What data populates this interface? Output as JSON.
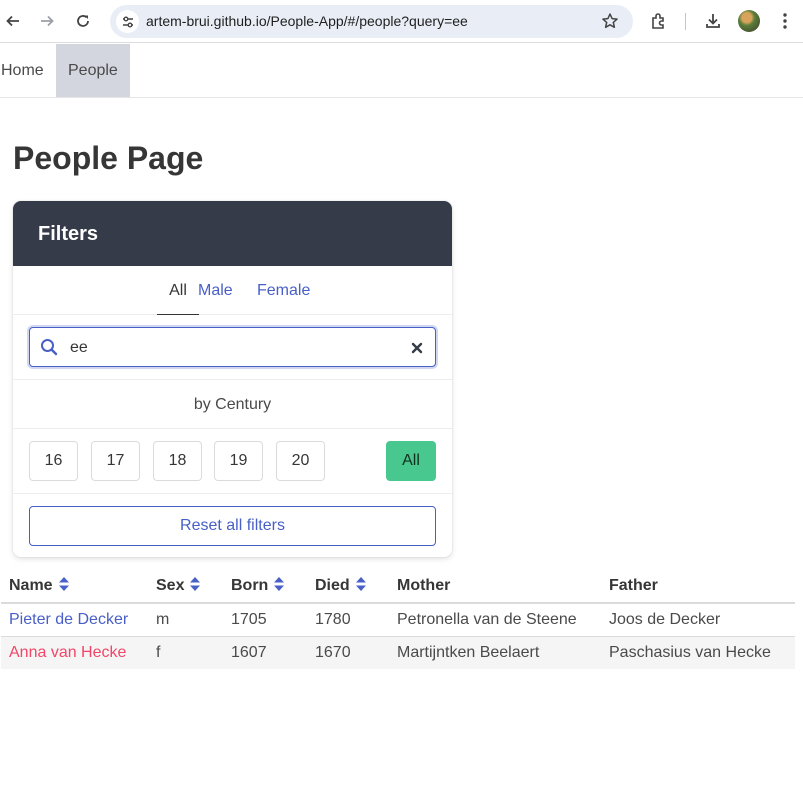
{
  "browser": {
    "url": "artem-brui.github.io/People-App/#/people?query=ee"
  },
  "navbar": {
    "items": [
      {
        "label": "Home"
      },
      {
        "label": "People"
      }
    ]
  },
  "page": {
    "title": "People Page"
  },
  "filters": {
    "heading": "Filters",
    "tabs": [
      {
        "label": "All"
      },
      {
        "label": "Male"
      },
      {
        "label": "Female"
      }
    ],
    "search": {
      "value": "ee"
    },
    "century_label": "by Century",
    "centuries": [
      "16",
      "17",
      "18",
      "19",
      "20"
    ],
    "all_label": "All",
    "reset_label": "Reset all filters"
  },
  "table": {
    "headers": [
      "Name",
      "Sex",
      "Born",
      "Died",
      "Mother",
      "Father"
    ],
    "rows": [
      {
        "name": "Pieter de Decker",
        "sex": "m",
        "born": "1705",
        "died": "1780",
        "mother": "Petronella van de Steene",
        "father": "Joos de Decker"
      },
      {
        "name": "Anna van Hecke",
        "sex": "f",
        "born": "1607",
        "died": "1670",
        "mother": "Martijntken Beelaert",
        "father": "Paschasius van Hecke"
      }
    ]
  },
  "colors": {
    "link": "#485fc7",
    "female": "#f14668",
    "success": "#48c78e",
    "panel_heading": "#363b49"
  }
}
